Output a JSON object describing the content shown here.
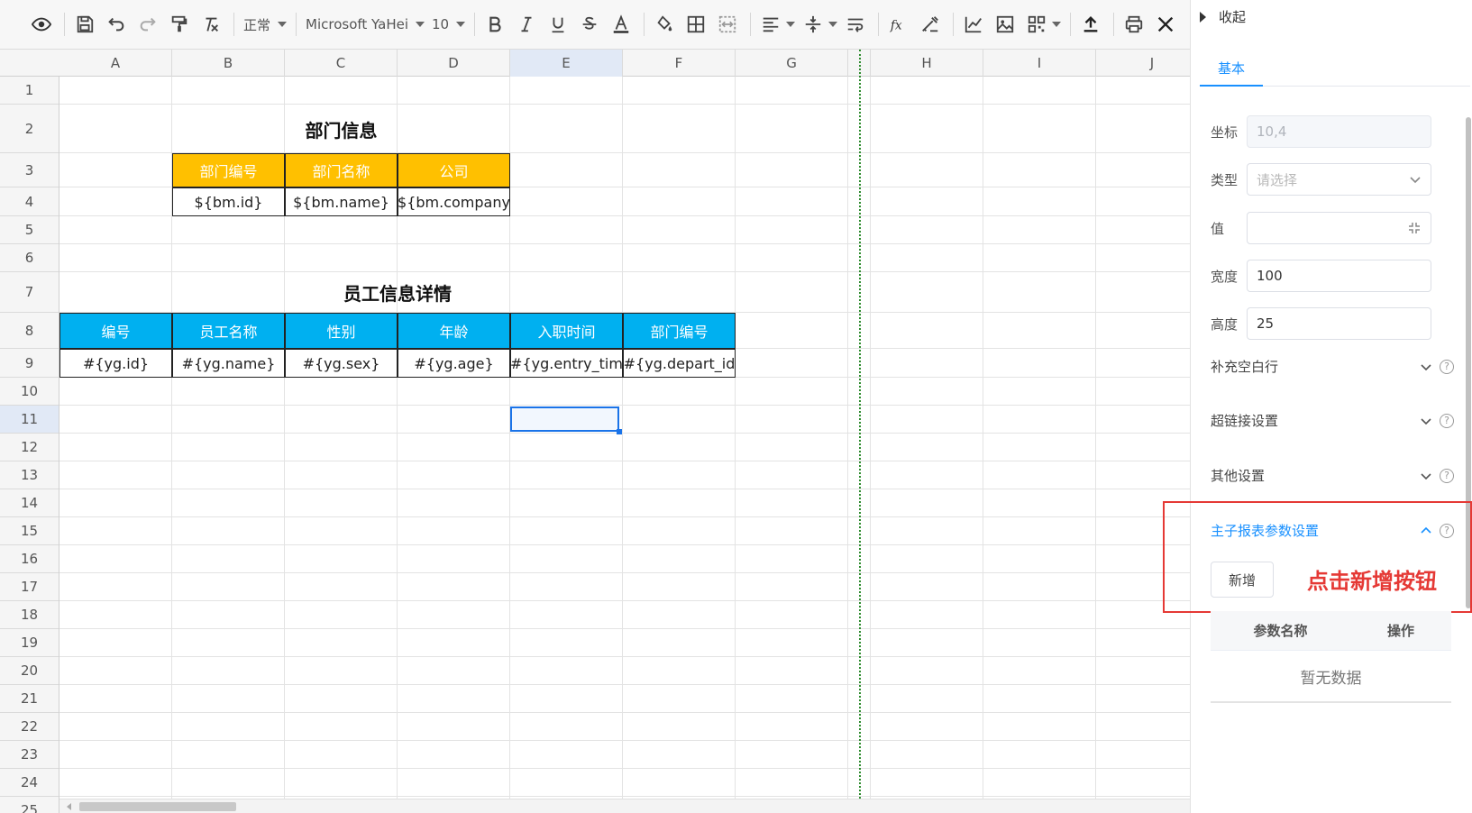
{
  "toolbar": {
    "style_select": "正常",
    "font_select": "Microsoft YaHei",
    "size_select": "10"
  },
  "sheet": {
    "columns": [
      "A",
      "B",
      "C",
      "D",
      "E",
      "F",
      "G",
      "",
      "H",
      "I",
      "J"
    ],
    "rows": [
      "1",
      "2",
      "3",
      "4",
      "5",
      "6",
      "7",
      "8",
      "9",
      "10",
      "11",
      "12",
      "13",
      "14",
      "15",
      "16",
      "17",
      "18",
      "19",
      "20",
      "21",
      "22",
      "23",
      "24",
      "25"
    ],
    "active_column": "E",
    "active_row": "11",
    "dept": {
      "title": "部门信息",
      "headers": [
        "部门编号",
        "部门名称",
        "公司"
      ],
      "values": [
        "${bm.id}",
        "${bm.name}",
        "${bm.company"
      ]
    },
    "emp": {
      "title": "员工信息详情",
      "headers": [
        "编号",
        "员工名称",
        "性别",
        "年龄",
        "入职时间",
        "部门编号"
      ],
      "values": [
        "#{yg.id}",
        "#{yg.name}",
        "#{yg.sex}",
        "#{yg.age}",
        "#{yg.entry_tim",
        "#{yg.depart_id"
      ]
    },
    "header_colors": {
      "orange": "#ffc000",
      "blue": "#00b0f0"
    }
  },
  "panel": {
    "collapse_label": "收起",
    "tab_basic": "基本",
    "coord_label": "坐标",
    "coord_value": "10,4",
    "type_label": "类型",
    "type_placeholder": "请选择",
    "value_label": "值",
    "width_label": "宽度",
    "width_value": "100",
    "height_label": "高度",
    "height_value": "25",
    "fill_rows_label": "补充空白行",
    "hyperlink_label": "超链接设置",
    "other_label": "其他设置",
    "master_label": "主子报表参数设置",
    "add_label": "新增",
    "annotation": "点击新增按钮",
    "param_name_col": "参数名称",
    "action_col": "操作",
    "empty_text": "暂无数据",
    "accent": "#1890ff",
    "highlight": "#e53935"
  }
}
